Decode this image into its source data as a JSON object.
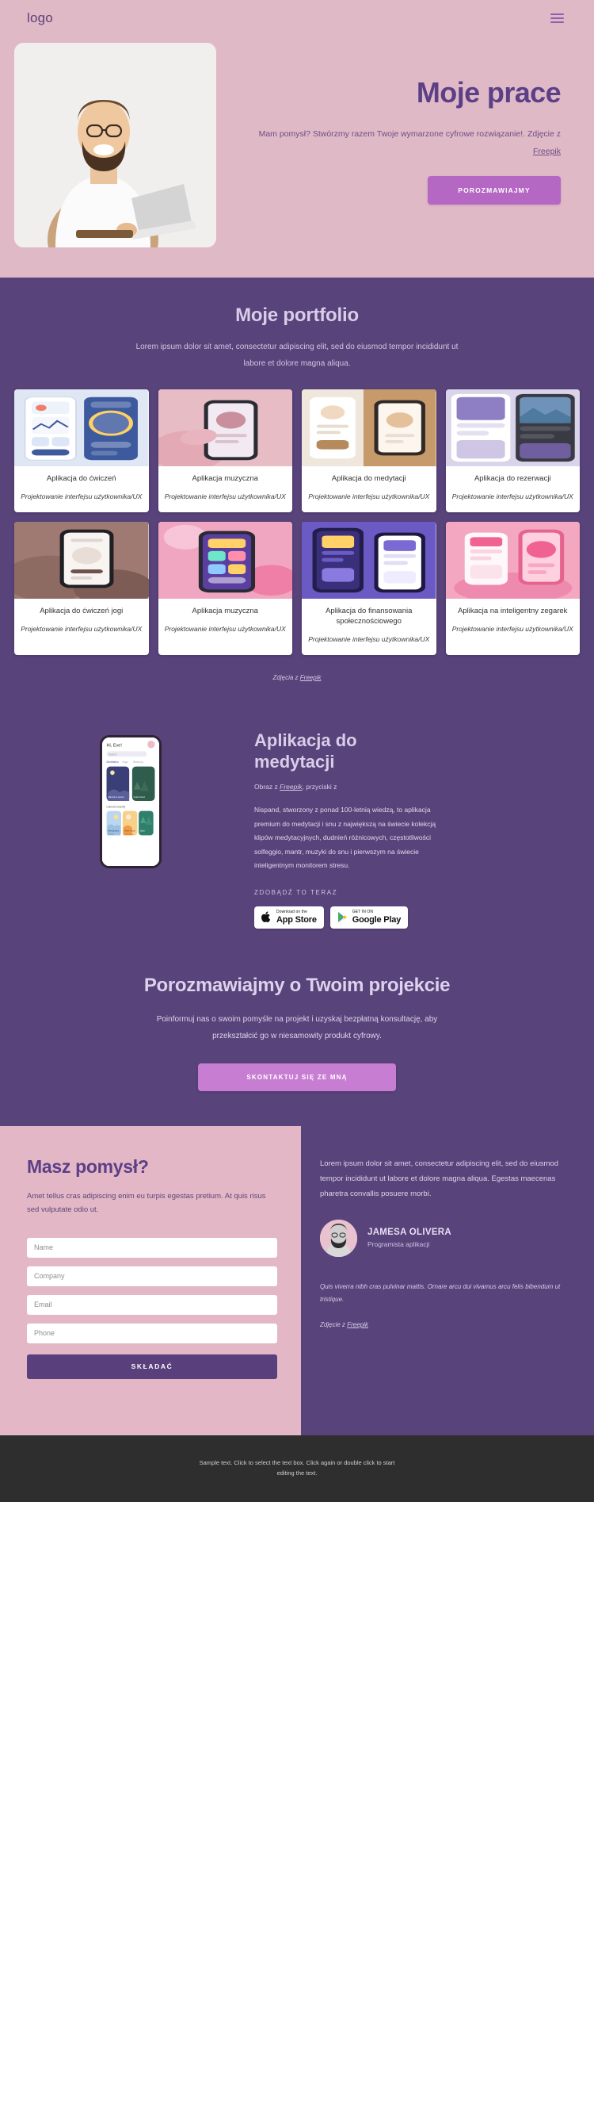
{
  "nav": {
    "logo": "logo",
    "menu_icon": "hamburger-icon"
  },
  "hero": {
    "title": "Moje prace",
    "subtitle": "Mam pomysł? Stwórzmy razem Twoje wymarzone cyfrowe rozwiązanie!. Zdjęcie z",
    "subtitle_link": "Freepik",
    "cta": "POROZMAWIAJMY",
    "photo_alt": "man-with-laptop-photo"
  },
  "portfolio": {
    "title": "Moje portfolio",
    "subtitle": "Lorem ipsum dolor sit amet, consectetur adipiscing elit, sed do eiusmod tempor incididunt ut labore et dolore magna aliqua.",
    "credit_prefix": "Zdjęcia z",
    "credit_link": "Freepik",
    "cards": [
      {
        "title": "Aplikacja do ćwiczeń",
        "role": "Projektowanie interfejsu użytkownika/UX",
        "c1": "#dfe7f5",
        "c2": "#3d5a9e",
        "style": "fitness"
      },
      {
        "title": "Aplikacja muzyczna",
        "role": "Projektowanie interfejsu użytkownika/UX",
        "c1": "#e8bcc4",
        "c2": "#c98f9c",
        "style": "handphone"
      },
      {
        "title": "Aplikacja do medytacji",
        "role": "Projektowanie interfejsu użytkownika/UX",
        "c1": "#f2ece6",
        "c2": "#b78a5e",
        "style": "meditation"
      },
      {
        "title": "Aplikacja do rezerwacji",
        "role": "Projektowanie interfejsu użytkownika/UX",
        "c1": "#d9d4ea",
        "c2": "#6f5f9e",
        "style": "booking"
      },
      {
        "title": "Aplikacja do ćwiczeń jogi",
        "role": "Projektowanie interfejsu użytkownika/UX",
        "c1": "#9f7a72",
        "c2": "#6e504c",
        "style": "yoga"
      },
      {
        "title": "Aplikacja muzyczna",
        "role": "Projektowanie interfejsu użytkownika/UX",
        "c1": "#f0a6c0",
        "c2": "#e4648d",
        "style": "music2"
      },
      {
        "title": "Aplikacja do finansowania społecznościowego",
        "role": "Projektowanie interfejsu użytkownika/UX",
        "c1": "#7b69d4",
        "c2": "#4e3fa3",
        "style": "crowd"
      },
      {
        "title": "Aplikacja na inteligentny zegarek",
        "role": "Projektowanie interfejsu użytkownika/UX",
        "c1": "#f4a7c0",
        "c2": "#e56f9a",
        "style": "watch"
      }
    ]
  },
  "meditation": {
    "title": "Aplikacja do medytacji",
    "credit_prefix": "Obraz z",
    "credit_link": "Freepik",
    "credit_suffix": ", przyciski z",
    "paragraph": "Nispand, stworzony z ponad 100-letnią wiedzą, to aplikacja premium do medytacji i snu z największą na świecie kolekcją klipów medytacyjnych, dudnień różnicowych, częstotliwości solfeggio, mantr, muzyki do snu i pierwszym na świecie inteligentnym monitorem stresu.",
    "cta_label": "ZDOBĄDŹ TO TERAZ",
    "app_store": {
      "small": "Download on the",
      "big": "App Store",
      "icon": "apple-icon"
    },
    "google_play": {
      "small": "GET IN ON",
      "big": "Google Play",
      "icon": "google-play-icon"
    },
    "phone_screen": {
      "greeting": "Hi, Eve!",
      "search_placeholder": "Search",
      "tabs": [
        "Meditation",
        "Yoga",
        "Sleeping"
      ],
      "card1": "Maximum power",
      "card2": "Quiet forest",
      "section": "Listened recently",
      "tile1": "Mind journey",
      "tile2": "Power sound",
      "tile3": "Quiet"
    }
  },
  "talk": {
    "title": "Porozmawiajmy o Twoim projekcie",
    "paragraph": "Poinformuj nas o swoim pomyśle na projekt i uzyskaj bezpłatną konsultację, aby przekształcić go w niesamowity produkt cyfrowy.",
    "cta": "SKONTAKTUJ SIĘ ZE MNĄ"
  },
  "contact": {
    "title": "Masz pomysł?",
    "paragraph": "Amet tellus cras adipiscing enim eu turpis egestas pretium. At quis risus sed vulputate odio ut.",
    "fields": [
      {
        "name": "name",
        "placeholder": "Name",
        "value": ""
      },
      {
        "name": "company",
        "placeholder": "Company",
        "value": ""
      },
      {
        "name": "email",
        "placeholder": "Email",
        "value": ""
      },
      {
        "name": "phone",
        "placeholder": "Phone",
        "value": ""
      }
    ],
    "submit": "SKŁADAĆ",
    "quote": "Lorem ipsum dolor sit amet, consectetur adipiscing elit, sed do eiusmod tempor incididunt ut labore et dolore magna aliqua. Egestas maecenas pharetra convallis posuere morbi.",
    "person_name": "JAMESA OLIVERA",
    "person_role": "Programista aplikacji",
    "small_italic": "Quis viverra nibh cras pulvinar mattis. Ornare arcu dui vivamus arcu felis bibendum ut tristique.",
    "credit_prefix": "Zdjęcie z",
    "credit_link": "Freepik"
  },
  "footer": {
    "text": "Sample text. Click to select the text box. Click again or double click to start editing the text."
  },
  "colors": {
    "hero_bg": "#e0b9c6",
    "purple_bg": "#58437a",
    "accent_purple": "#5b3f87",
    "accent_pink_btn": "#b567c4",
    "footer_bg": "#2e2e2e"
  }
}
